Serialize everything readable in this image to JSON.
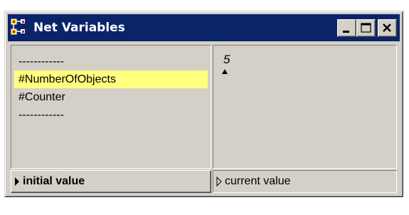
{
  "window": {
    "title": "Net Variables",
    "app_icon": "net-graph-icon",
    "controls": {
      "minimize_icon": "minimize-icon",
      "maximize_icon": "maximize-icon",
      "close_icon": "close-icon"
    }
  },
  "variables": {
    "items": [
      {
        "label": "------------",
        "selected": false
      },
      {
        "label": "#NumberOfObjects",
        "selected": true
      },
      {
        "label": "#Counter",
        "selected": false
      },
      {
        "label": "------------",
        "selected": false
      }
    ]
  },
  "value_pane": {
    "value": "5",
    "cursor_icon": "insertion-caret-icon"
  },
  "footer": {
    "left": {
      "label": "initial value",
      "icon": "triangle-right-filled-icon"
    },
    "right": {
      "label": "current value",
      "icon": "triangle-right-outline-icon"
    }
  },
  "colors": {
    "titlebar": "#0a246a",
    "selection": "#ffff80",
    "face": "#d4d0c8"
  }
}
